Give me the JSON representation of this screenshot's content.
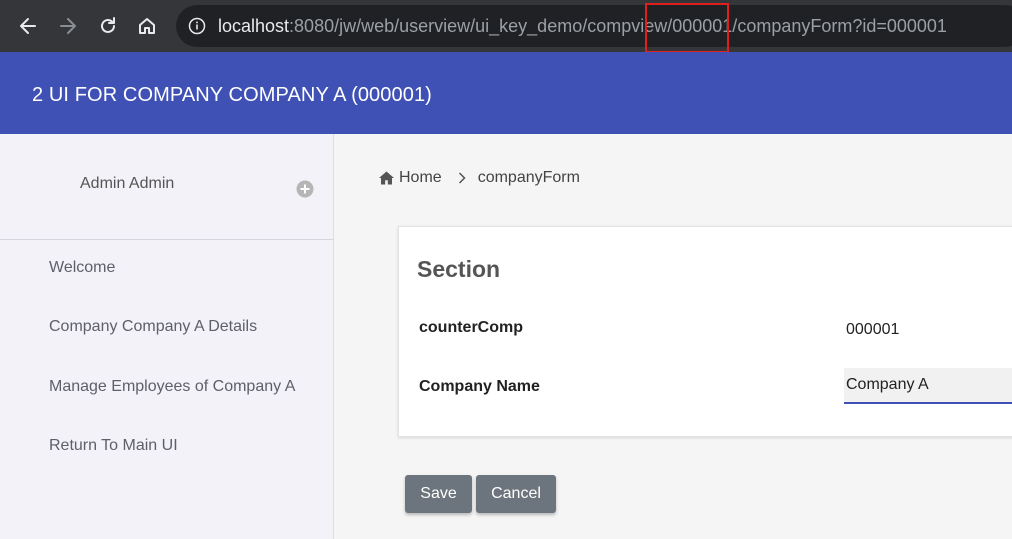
{
  "browser": {
    "url_host": "localhost",
    "url_path_before": ":8080/jw/web/userview/ui_key_demo/compview/",
    "url_path_highlight": "000001/",
    "url_path_after": "companyForm?id=000001",
    "icons": [
      "back-arrow-icon",
      "forward-arrow-icon",
      "reload-icon",
      "home-icon",
      "info-icon"
    ],
    "highlight_color": "#e0201c"
  },
  "header": {
    "title": "2 UI FOR COMPANY COMPANY A (000001)",
    "color": "#3f51b5"
  },
  "sidebar": {
    "user_name": "Admin Admin",
    "items": [
      {
        "label": "Welcome"
      },
      {
        "label": "Company Company A Details"
      },
      {
        "label": "Manage Employees of Company A"
      },
      {
        "label": "Return To Main UI"
      }
    ]
  },
  "breadcrumb": {
    "home": "Home",
    "current": "companyForm"
  },
  "form": {
    "section_title": "Section",
    "counter_label": "counterComp",
    "counter_value": "000001",
    "company_name_label": "Company Name",
    "company_name_value": "Company A"
  },
  "buttons": {
    "save": "Save",
    "cancel": "Cancel"
  }
}
